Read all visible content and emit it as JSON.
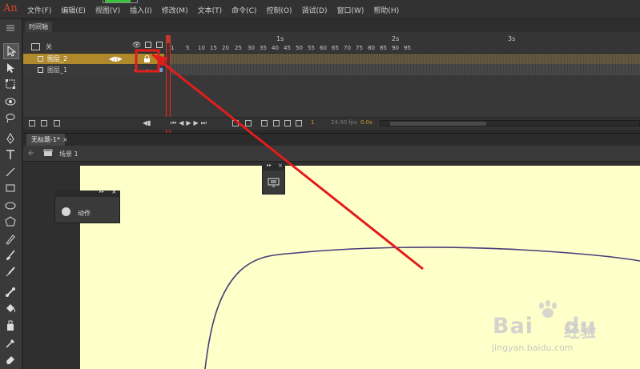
{
  "app": {
    "logo": "An"
  },
  "menu": [
    {
      "label": "文件(F)"
    },
    {
      "label": "编辑(E)"
    },
    {
      "label": "视图(V)"
    },
    {
      "label": "插入(I)"
    },
    {
      "label": "修改(M)"
    },
    {
      "label": "文本(T)"
    },
    {
      "label": "命令(C)"
    },
    {
      "label": "控制(O)"
    },
    {
      "label": "调试(D)"
    },
    {
      "label": "窗口(W)"
    },
    {
      "label": "帮助(H)"
    }
  ],
  "timeline": {
    "tab_label": "时间轴",
    "header_label": "关",
    "layers": [
      {
        "name": "图层_2",
        "selected": true,
        "locked": true
      },
      {
        "name": "图层_1",
        "selected": false,
        "locked": false
      }
    ],
    "ruler_seconds": [
      "1s",
      "2s",
      "3s"
    ],
    "ruler_frames": [
      "1",
      "5",
      "10",
      "15",
      "20",
      "25",
      "30",
      "35",
      "40",
      "45",
      "50",
      "55",
      "60",
      "65",
      "70",
      "75",
      "80",
      "85",
      "90",
      "95"
    ],
    "current_frame": "1",
    "fps": "24.00 fps",
    "time": "0.0s"
  },
  "document": {
    "tab_label": "无标题-1*",
    "close_glyph": "×",
    "scene_label": "场景 1"
  },
  "panels": {
    "actions_label": "动作"
  },
  "watermark": {
    "brand": "Bai",
    "brand2": "du",
    "cn": "经验",
    "url": "jingyan.baidu.com"
  },
  "colors": {
    "accent_layer": "#b0892c",
    "annotation": "#e31c1c",
    "stage": "#ffffc9",
    "curve": "#4a3a7a"
  }
}
